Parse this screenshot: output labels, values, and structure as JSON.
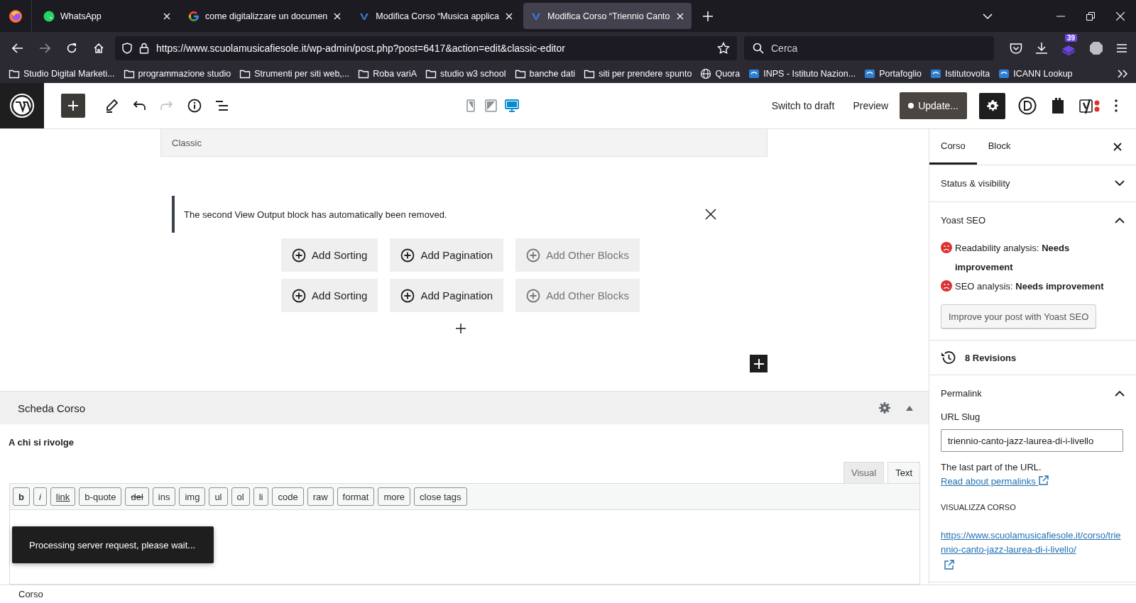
{
  "browser": {
    "tabs": [
      {
        "title": "WhatsApp",
        "kind": "whatsapp",
        "selected": false
      },
      {
        "title": "come digitalizzare un documen",
        "kind": "google",
        "selected": false
      },
      {
        "title": "Modifica Corso “Musica applica",
        "kind": "site",
        "selected": false
      },
      {
        "title": "Modifica Corso “Triennio Canto",
        "kind": "site",
        "selected": true
      }
    ],
    "url": "https://www.scuolamusicafiesole.it/wp-admin/post.php?post=6417&action=edit&classic-editor",
    "search": {
      "placeholder": "Cerca"
    },
    "extension_badge": "39",
    "bookmarks": [
      {
        "label": "Studio Digital Marketi...",
        "kind": "folder"
      },
      {
        "label": "programmazione studio",
        "kind": "folder"
      },
      {
        "label": "Strumenti per siti web,...",
        "kind": "folder"
      },
      {
        "label": "Roba variA",
        "kind": "folder"
      },
      {
        "label": "studio w3 school",
        "kind": "folder"
      },
      {
        "label": "banche dati",
        "kind": "folder"
      },
      {
        "label": "siti per prendere spunto",
        "kind": "folder"
      },
      {
        "label": "Quora",
        "kind": "globe"
      },
      {
        "label": "INPS - Istituto Nazion...",
        "kind": "site"
      },
      {
        "label": "Portafoglio",
        "kind": "site"
      },
      {
        "label": "Istitutovolta",
        "kind": "site"
      },
      {
        "label": "ICANN Lookup",
        "kind": "site"
      }
    ]
  },
  "toolbar": {
    "history": [
      {
        "kind": "undo",
        "disabled": false
      },
      {
        "kind": "redo",
        "disabled": true
      }
    ],
    "devices": [
      {
        "kind": "mobile",
        "selected": false
      },
      {
        "kind": "tablet",
        "selected": false
      },
      {
        "kind": "desktop",
        "selected": true
      }
    ],
    "switch_to_draft": "Switch to draft",
    "preview": "Preview",
    "update": "Update...",
    "settings": {
      "pressed": true
    }
  },
  "editor": {
    "block_label": "Classic",
    "notice": "The second View Output block has automatically been removed.",
    "button_rows": [
      [
        {
          "label": "Add Sorting",
          "disabled": false
        },
        {
          "label": "Add Pagination",
          "disabled": false
        },
        {
          "label": "Add Other Blocks",
          "disabled": true
        }
      ],
      [
        {
          "label": "Add Sorting",
          "disabled": false
        },
        {
          "label": "Add Pagination",
          "disabled": false
        },
        {
          "label": "Add Other Blocks",
          "disabled": true
        }
      ]
    ]
  },
  "metabox": {
    "title": "Scheda Corso",
    "field_label": "A chi si rivolge",
    "editor_tabs": [
      {
        "label": "Visual",
        "selected": false
      },
      {
        "label": "Text",
        "selected": true
      }
    ],
    "quicktags": [
      {
        "label": "b",
        "kind": "bold"
      },
      {
        "label": "i",
        "kind": "italic"
      },
      {
        "label": "link",
        "kind": "underline"
      },
      {
        "label": "b-quote",
        "kind": "plain"
      },
      {
        "label": "del",
        "kind": "strike"
      },
      {
        "label": "ins",
        "kind": "plain"
      },
      {
        "label": "img",
        "kind": "plain"
      },
      {
        "label": "ul",
        "kind": "plain"
      },
      {
        "label": "ol",
        "kind": "plain"
      },
      {
        "label": "li",
        "kind": "plain"
      },
      {
        "label": "code",
        "kind": "plain"
      },
      {
        "label": "raw",
        "kind": "plain"
      },
      {
        "label": "format",
        "kind": "plain"
      },
      {
        "label": "more",
        "kind": "plain"
      },
      {
        "label": "close tags",
        "kind": "plain"
      }
    ],
    "toast": "Processing server request, please wait..."
  },
  "sidebar": {
    "tabs": [
      {
        "label": "Corso",
        "selected": true
      },
      {
        "label": "Block",
        "selected": false
      }
    ],
    "panels": [
      {
        "kind": "section",
        "title": "Status & visibility",
        "expanded": false
      },
      {
        "kind": "yoast",
        "title": "Yoast SEO",
        "expanded": true,
        "analyses": [
          "Readability analysis: **Needs improvement**",
          "SEO analysis: **Needs improvement**"
        ],
        "button": "Improve your post with Yoast SEO"
      },
      {
        "kind": "revisions",
        "label": "8 Revisions"
      },
      {
        "kind": "permalink",
        "title": "Permalink",
        "expanded": true,
        "slug_label": "URL Slug",
        "slug": "triennio-canto-jazz-laurea-di-i-livello",
        "help": "The last part of the URL.",
        "help_link": "Read about permalinks",
        "view_heading": "VISUALIZZA CORSO",
        "view_link": "https://www.scuolamusicafiesole.it/corso/triennio-canto-jazz-laurea-di-i-livello/"
      }
    ]
  },
  "footer": {
    "breadcrumb": "Corso"
  }
}
